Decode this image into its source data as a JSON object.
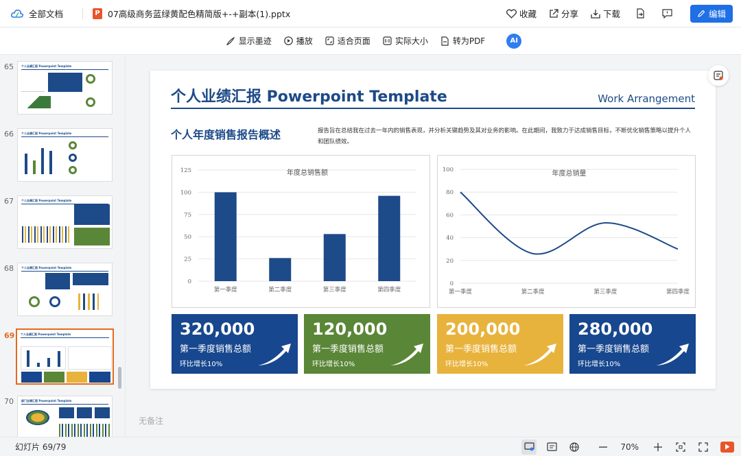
{
  "topbar": {
    "all_files": "全部文档",
    "file_icon_letter": "P",
    "filename": "07高级商务蓝绿黄配色精简版+-+副本(1).pptx",
    "favorite": "收藏",
    "share": "分享",
    "download": "下载",
    "edit": "编辑"
  },
  "toolbar": {
    "ink": "显示墨迹",
    "play": "播放",
    "fit_page": "适合页面",
    "actual_size": "实际大小",
    "to_pdf": "转为PDF",
    "ai": "AI"
  },
  "thumbnails": [
    {
      "num": "65",
      "title": "个人业绩汇报 Powerpoint Template"
    },
    {
      "num": "66",
      "title": "个人业绩汇报 Powerpoint Template"
    },
    {
      "num": "67",
      "title": "个人业绩汇报 Powerpoint Template"
    },
    {
      "num": "68",
      "title": "个人业绩汇报 Powerpoint Template"
    },
    {
      "num": "69",
      "title": "个人业绩汇报 Powerpoint Template",
      "active": true
    },
    {
      "num": "70",
      "title": "部门业绩汇报 Powerpoint Template"
    }
  ],
  "slide": {
    "title": "个人业绩汇报 Powerpoint Template",
    "subtitle_right": "Work Arrangement",
    "section_heading": "个人年度销售报告概述",
    "description": "报告旨在总结我在过去一年内的销售表现，并分析关键趋势及其对业务的影响。在此期间，我致力于达成销售目标，不断优化销售策略以提升个人和团队绩效。",
    "cards": [
      {
        "value": "320,000",
        "label": "第一季度销售总额",
        "growth": "环比增长10%",
        "color": "#17478e"
      },
      {
        "value": "120,000",
        "label": "第一季度销售总额",
        "growth": "环比增长10%",
        "color": "#5a8637"
      },
      {
        "value": "200,000",
        "label": "第一季度销售总额",
        "growth": "环比增长10%",
        "color": "#e8b33c"
      },
      {
        "value": "280,000",
        "label": "第一季度销售总额",
        "growth": "环比增长10%",
        "color": "#17478e"
      }
    ]
  },
  "chart_data": [
    {
      "type": "bar",
      "title": "年度总销售额",
      "categories": [
        "第一季度",
        "第二季度",
        "第三季度",
        "第四季度"
      ],
      "values": [
        100,
        26,
        53,
        96
      ],
      "ylim": [
        0,
        125
      ],
      "yticks": [
        "0",
        "25",
        "50",
        "75",
        "100",
        "125"
      ],
      "grid": true,
      "color": "#1d4a88"
    },
    {
      "type": "line",
      "title": "年度总销量",
      "categories": [
        "第一季度",
        "第二季度",
        "第三季度",
        "第四季度"
      ],
      "values": [
        80,
        26,
        53,
        30
      ],
      "ylim": [
        0,
        100
      ],
      "yticks": [
        "0",
        "20",
        "40",
        "60",
        "80",
        "100"
      ],
      "grid": true,
      "color": "#1d4a88"
    }
  ],
  "notes": "无备注",
  "status": {
    "slide_counter": "幻灯片 69/79",
    "zoom": "70%"
  }
}
